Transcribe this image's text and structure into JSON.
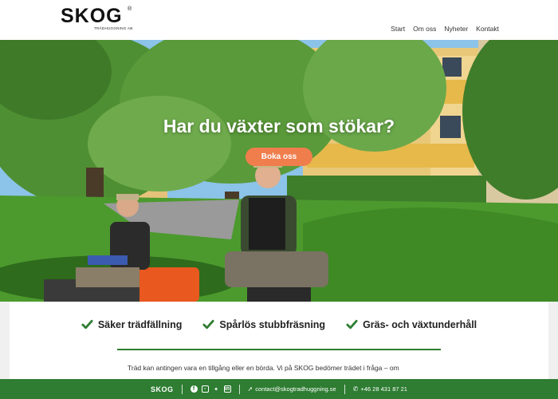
{
  "brand": {
    "name": "SKOG",
    "subtitle": "TRÄDHUGGNING AB",
    "reg": "®"
  },
  "nav": {
    "items": [
      "Start",
      "Om oss",
      "Nyheter",
      "Kontakt"
    ]
  },
  "hero": {
    "title": "Har du växter som stökar?",
    "cta": "Boka oss"
  },
  "features": [
    {
      "label": "Säker trädfällning",
      "icon": "check-icon"
    },
    {
      "label": "Spårlös stubbfräsning",
      "icon": "check-icon"
    },
    {
      "label": "Gräs- och växtunderhåll",
      "icon": "check-icon"
    }
  ],
  "intro": {
    "text": "Träd kan antingen vara en tillgång eller en börda. Vi på SKOG bedömer trädet i fråga – om"
  },
  "footer": {
    "logo": "SKOG",
    "socials": [
      "facebook-icon",
      "instagram-icon",
      "twitter-icon",
      "linkedin-icon"
    ],
    "email": "contact@skogtradhuggning.se",
    "phone": "+46 28 431 87 21"
  },
  "colors": {
    "brand_green": "#2e7d32",
    "cta_orange": "#f07e4d"
  }
}
